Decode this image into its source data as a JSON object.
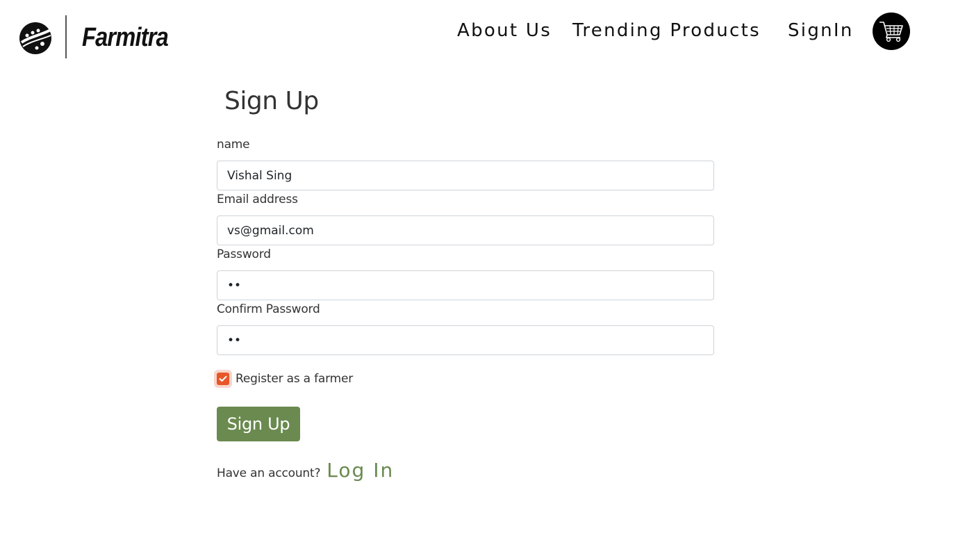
{
  "header": {
    "brand_name": "Farmitra",
    "nav": {
      "about": "About Us",
      "trending": "Trending Products",
      "signin": "SignIn"
    }
  },
  "form": {
    "title": "Sign Up",
    "name_label": "name",
    "name_value": "Vishal Sing",
    "email_label": "Email address",
    "email_value": "vs@gmail.com",
    "password_label": "Password",
    "password_value": "••",
    "confirm_label": "Confirm Password",
    "confirm_value": "••",
    "farmer_checkbox_label": "Register as a farmer",
    "farmer_checked": true,
    "submit_label": "Sign Up",
    "account_prompt": "Have an account?",
    "login_label": "Log In"
  },
  "colors": {
    "accent_green": "#6a8a4f",
    "checkbox_orange": "#e8572a"
  },
  "icons": {
    "logo": "leaf-badge-icon",
    "cart": "shopping-cart-icon",
    "check": "check-icon"
  }
}
